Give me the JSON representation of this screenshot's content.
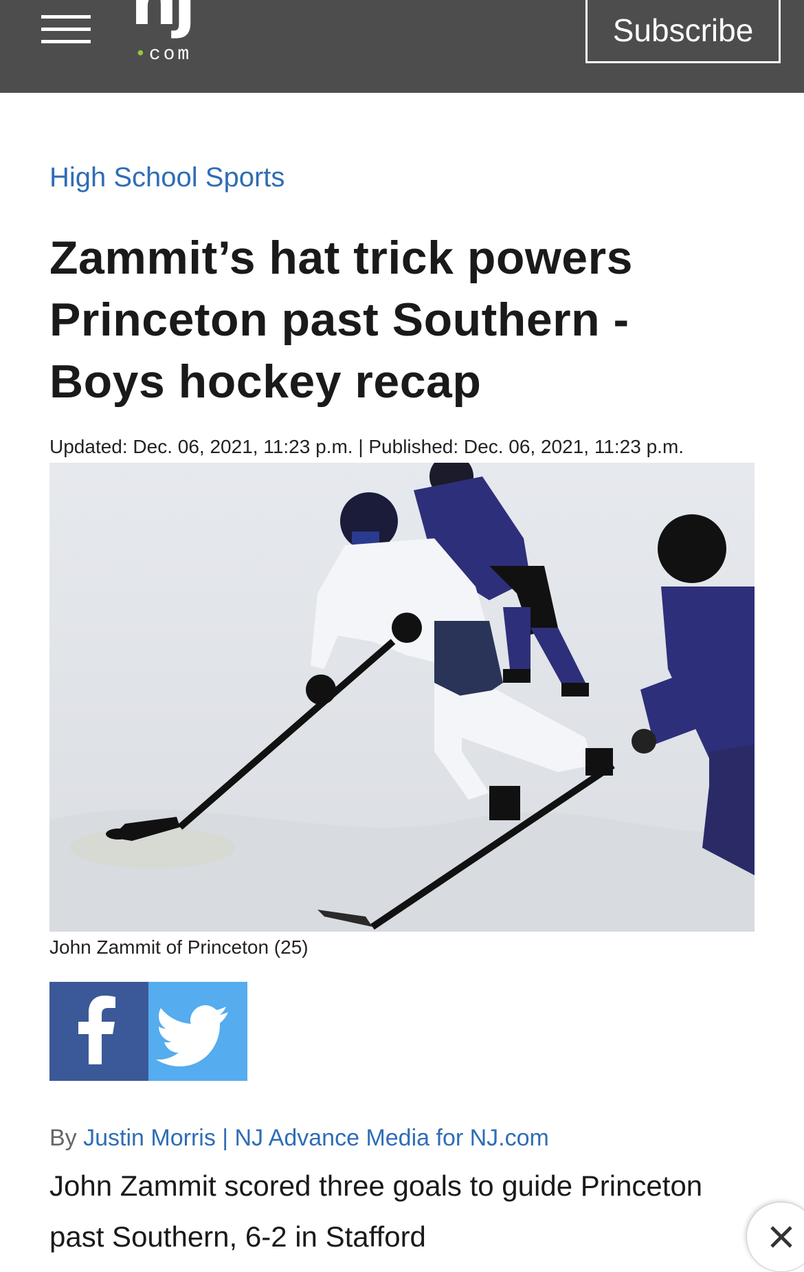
{
  "header": {
    "logo_main": "nj",
    "logo_dot": "•",
    "logo_suffix": "com",
    "subscribe_label": "Subscribe",
    "background_color": "#4d4d4d",
    "logo_dot_color": "#9bc53d"
  },
  "article": {
    "section": "High School Sports",
    "headline": "Zammit’s hat trick powers Princeton past Southern - Boys hockey recap",
    "dateline": "Updated: Dec. 06, 2021, 11:23 p.m. | Published: Dec. 06, 2021, 11:23 p.m.",
    "photo_caption": "John Zammit of Princeton (25)",
    "byline_prefix": "By",
    "byline_author": "Justin Morris | NJ Advance Media for NJ.com",
    "body_lead": "John Zammit scored three goals to guide Princeton past Southern, 6-2 in Stafford",
    "link_color": "#2f6db5"
  },
  "share": {
    "facebook_icon": "facebook-icon",
    "twitter_icon": "twitter-icon",
    "facebook_color": "#3b5998",
    "twitter_color": "#55acee"
  },
  "overlay": {
    "close_icon": "close-icon"
  }
}
